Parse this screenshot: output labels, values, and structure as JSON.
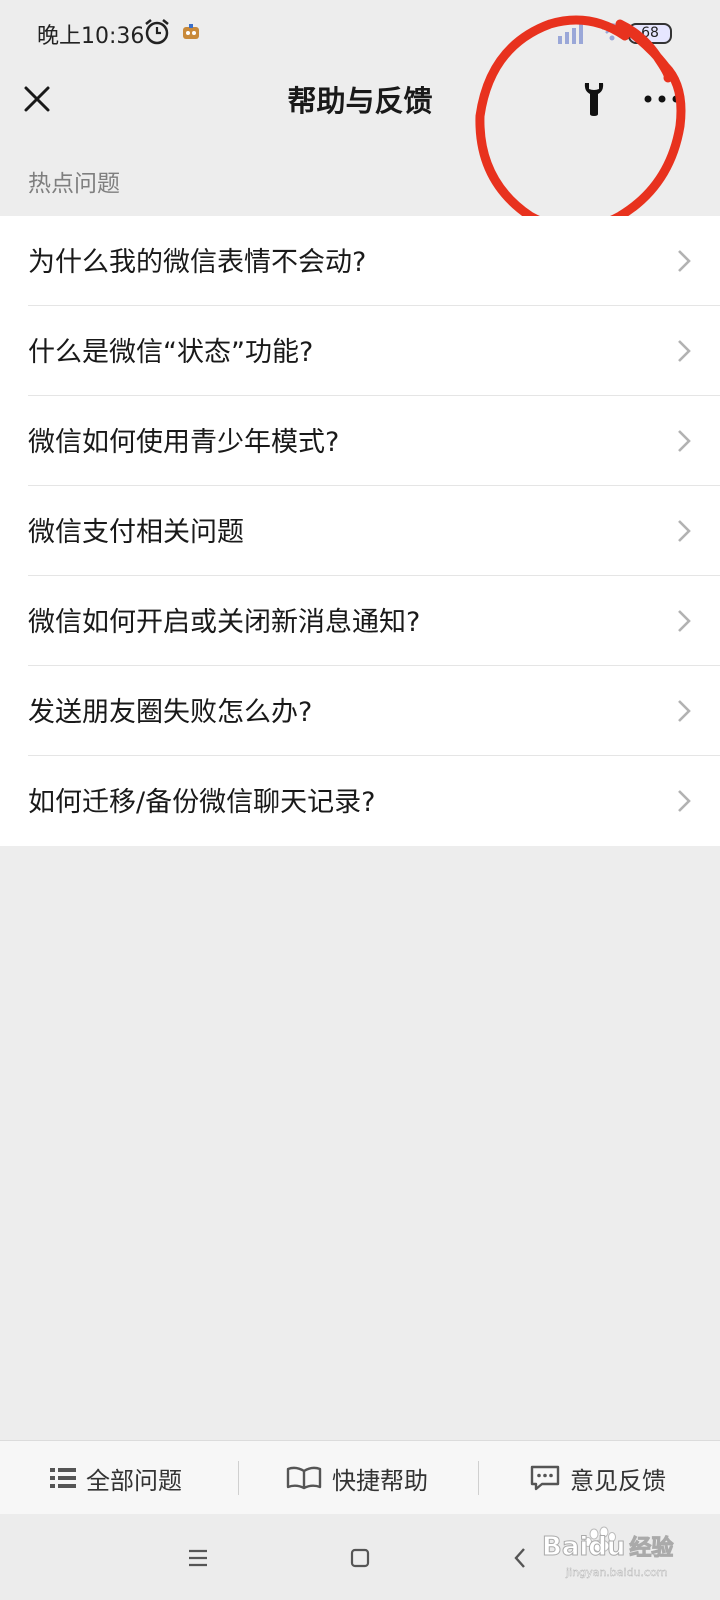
{
  "status_bar": {
    "time": "晚上10:36",
    "battery": "68",
    "icons": [
      "alarm-icon",
      "app-notification-icon",
      "signal-icon",
      "wifi-icon",
      "battery-icon"
    ]
  },
  "nav": {
    "title": "帮助与反馈",
    "close_icon": "close-icon",
    "tool_icon": "wrench-icon",
    "more_icon": "more-icon"
  },
  "annotation": {
    "color": "#e8321e",
    "shape": "hand-drawn-circle"
  },
  "section": {
    "label": "热点问题"
  },
  "faq": [
    {
      "label": "为什么我的微信表情不会动?"
    },
    {
      "label": "什么是微信“状态”功能?"
    },
    {
      "label": "微信如何使用青少年模式?"
    },
    {
      "label": "微信支付相关问题"
    },
    {
      "label": "微信如何开启或关闭新消息通知?"
    },
    {
      "label": "发送朋友圈失败怎么办?"
    },
    {
      "label": "如何迁移/备份微信聊天记录?"
    }
  ],
  "tabs": [
    {
      "label": "全部问题",
      "icon": "list-icon"
    },
    {
      "label": "快捷帮助",
      "icon": "book-icon"
    },
    {
      "label": "意见反馈",
      "icon": "chat-bubble-icon"
    }
  ],
  "system_nav": {
    "icons": [
      "menu-icon",
      "home-icon",
      "back-icon"
    ]
  },
  "watermark": {
    "brand": "Baidu",
    "suffix": "经验",
    "url": "jingyan.baidu.com"
  }
}
